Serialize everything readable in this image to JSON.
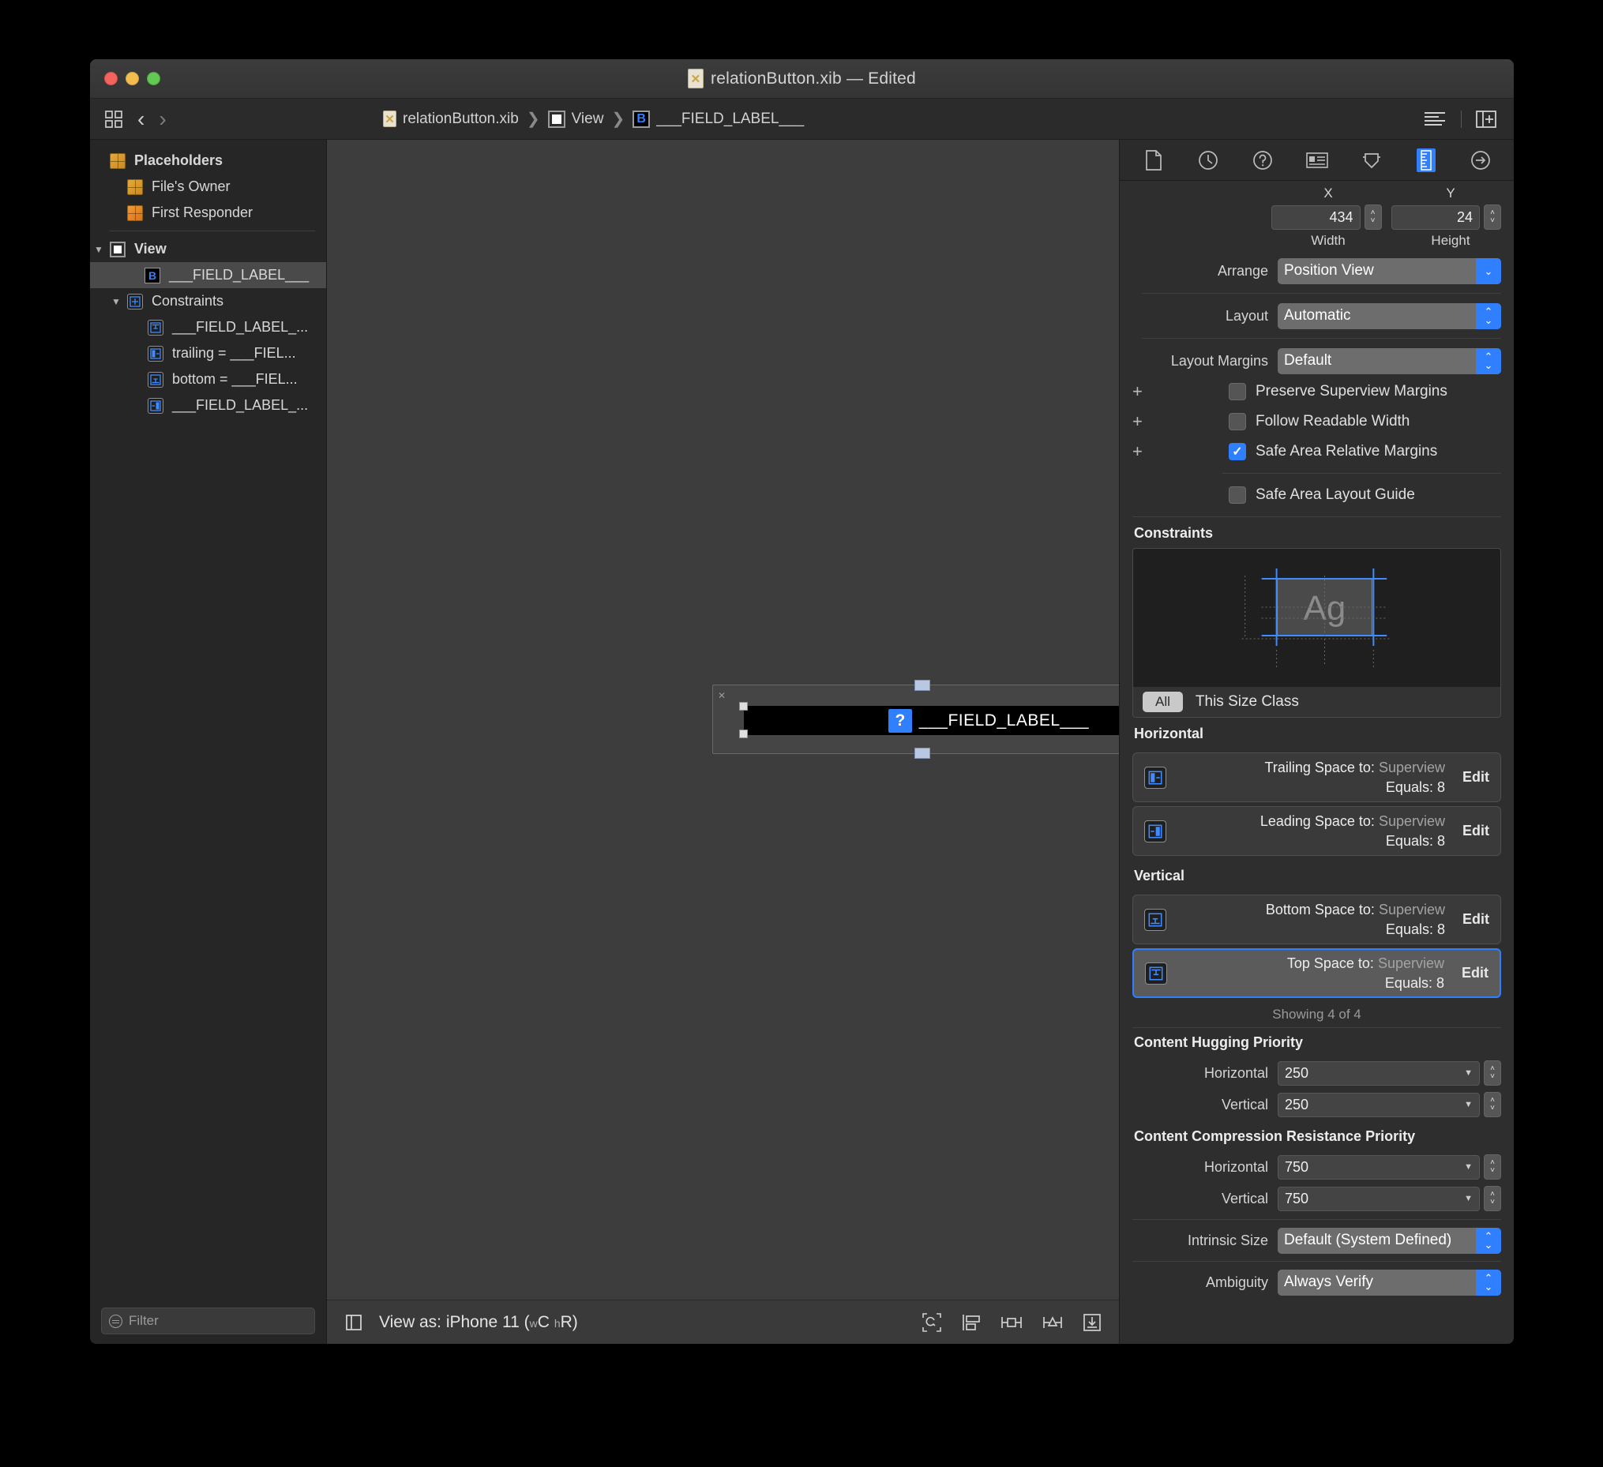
{
  "window": {
    "title": "relationButton.xib — Edited",
    "file_icon": "xib-file-icon"
  },
  "jumpbar": {
    "breadcrumbs": [
      {
        "icon": "xib-file-icon",
        "label": "relationButton.xib"
      },
      {
        "icon": "view-square-icon",
        "label": "View"
      },
      {
        "icon": "button-b-icon",
        "label": "___FIELD_LABEL___"
      }
    ],
    "back_label": "‹",
    "forward_label": "›"
  },
  "outline": {
    "items": [
      {
        "label": "Placeholders",
        "icon": "placeholder-cube-icon",
        "indent": 0,
        "bold": true,
        "twisty": "",
        "selected": false
      },
      {
        "label": "File's Owner",
        "icon": "placeholder-cube-icon",
        "indent": 1,
        "bold": false,
        "twisty": "",
        "selected": false
      },
      {
        "label": "First Responder",
        "icon": "first-responder-cube-icon",
        "indent": 1,
        "bold": false,
        "twisty": "",
        "selected": false
      },
      {
        "label": "View",
        "icon": "view-square-icon",
        "indent": 0,
        "bold": true,
        "twisty": "▼",
        "selected": false
      },
      {
        "label": "___FIELD_LABEL___",
        "icon": "button-b-icon",
        "indent": 1,
        "bold": false,
        "twisty": "",
        "selected": true
      },
      {
        "label": "Constraints",
        "icon": "constraints-icon",
        "indent": 1,
        "bold": false,
        "twisty": "▼",
        "selected": false
      },
      {
        "label": "___FIELD_LABEL_...",
        "icon": "top-space-constraint-icon",
        "indent": 2,
        "bold": false,
        "twisty": "",
        "selected": false
      },
      {
        "label": "trailing = ___FIEL...",
        "icon": "trailing-space-constraint-icon",
        "indent": 2,
        "bold": false,
        "twisty": "",
        "selected": false
      },
      {
        "label": "bottom = ___FIEL...",
        "icon": "bottom-space-constraint-icon",
        "indent": 2,
        "bold": false,
        "twisty": "",
        "selected": false
      },
      {
        "label": "___FIELD_LABEL_...",
        "icon": "leading-space-constraint-icon",
        "indent": 2,
        "bold": false,
        "twisty": "",
        "selected": false
      }
    ],
    "filter_placeholder": "Filter"
  },
  "canvas": {
    "button_label": "___FIELD_LABEL___",
    "button_badge": "?"
  },
  "bottombar": {
    "view_as_prefix": "View as: iPhone 11 (",
    "view_as_w": "w",
    "view_as_wval": "C",
    "view_as_h": "h",
    "view_as_hval": "R",
    "view_as_suffix": ")"
  },
  "inspector": {
    "tabs": [
      {
        "name": "file-inspector-icon",
        "active": false
      },
      {
        "name": "history-inspector-icon",
        "active": false
      },
      {
        "name": "quick-help-inspector-icon",
        "active": false
      },
      {
        "name": "identity-inspector-icon",
        "active": false
      },
      {
        "name": "attributes-inspector-icon",
        "active": false
      },
      {
        "name": "size-inspector-icon",
        "active": true
      },
      {
        "name": "connections-inspector-icon",
        "active": false
      }
    ],
    "position": {
      "x_label": "X",
      "y_label": "Y",
      "x_value": "434",
      "y_value": "24",
      "width_label": "Width",
      "height_label": "Height"
    },
    "arrange_label": "Arrange",
    "arrange_value": "Position View",
    "layout_label": "Layout",
    "layout_value": "Automatic",
    "layout_margins_label": "Layout Margins",
    "layout_margins_value": "Default",
    "checkboxes": [
      {
        "label": "Preserve Superview Margins",
        "checked": false,
        "plus": "+"
      },
      {
        "label": "Follow Readable Width",
        "checked": false,
        "plus": "+"
      },
      {
        "label": "Safe Area Relative Margins",
        "checked": true,
        "plus": "+"
      },
      {
        "label": "Safe Area Layout Guide",
        "checked": false,
        "plus": ""
      }
    ],
    "constraints_header": "Constraints",
    "preview_glyph": "Ag",
    "size_class_pill": "All",
    "size_class_text": "This Size Class",
    "horizontal_header": "Horizontal",
    "vertical_header": "Vertical",
    "constraint_rows": [
      {
        "group": "horizontal",
        "icon": "trailing-space-constraint-icon",
        "title": "Trailing Space to:",
        "target": "Superview",
        "equals_label": "Equals:",
        "equals_value": "8",
        "edit": "Edit",
        "selected": false
      },
      {
        "group": "horizontal",
        "icon": "leading-space-constraint-icon",
        "title": "Leading Space to:",
        "target": "Superview",
        "equals_label": "Equals:",
        "equals_value": "8",
        "edit": "Edit",
        "selected": false
      },
      {
        "group": "vertical",
        "icon": "bottom-space-constraint-icon",
        "title": "Bottom Space to:",
        "target": "Superview",
        "equals_label": "Equals:",
        "equals_value": "8",
        "edit": "Edit",
        "selected": false
      },
      {
        "group": "vertical",
        "icon": "top-space-constraint-icon",
        "title": "Top Space to:",
        "target": "Superview",
        "equals_label": "Equals:",
        "equals_value": "8",
        "edit": "Edit",
        "selected": true
      }
    ],
    "showing_text": "Showing 4 of 4",
    "hugging_header": "Content Hugging Priority",
    "hugging_horizontal_label": "Horizontal",
    "hugging_horizontal_value": "250",
    "hugging_vertical_label": "Vertical",
    "hugging_vertical_value": "250",
    "compression_header": "Content Compression Resistance Priority",
    "compression_horizontal_label": "Horizontal",
    "compression_horizontal_value": "750",
    "compression_vertical_label": "Vertical",
    "compression_vertical_value": "750",
    "intrinsic_label": "Intrinsic Size",
    "intrinsic_value": "Default (System Defined)",
    "ambiguity_label": "Ambiguity",
    "ambiguity_value": "Always Verify"
  },
  "colors": {
    "accent": "#2f7fff",
    "window_bg": "#323232",
    "panel_bg": "#2e2e2e",
    "canvas_bg": "#3d3d3d"
  }
}
